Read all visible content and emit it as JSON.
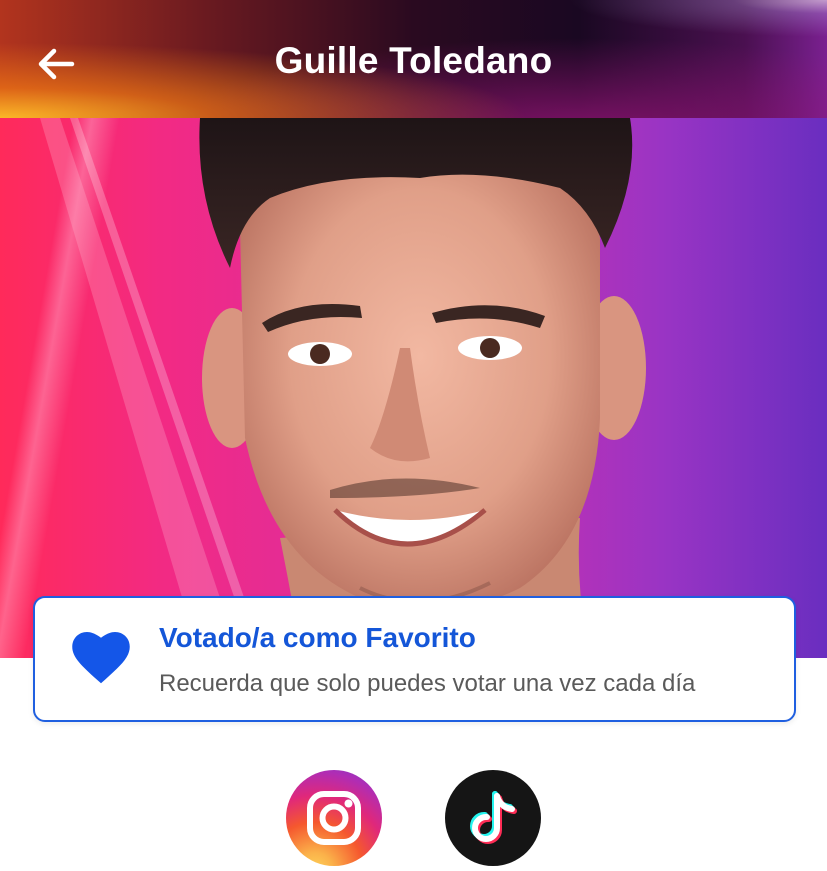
{
  "header": {
    "title": "Guille Toledano"
  },
  "icons": {
    "back": "arrow-left-icon",
    "heart": "heart-icon",
    "instagram": "instagram-icon",
    "tiktok": "tiktok-icon"
  },
  "vote_card": {
    "title": "Votado/a como Favorito",
    "subtitle": "Recuerda que solo puedes votar una vez cada día"
  },
  "colors": {
    "accent_blue": "#1456d8",
    "card_border": "#1f5fe0",
    "subtitle_gray": "#5a5a5a"
  }
}
